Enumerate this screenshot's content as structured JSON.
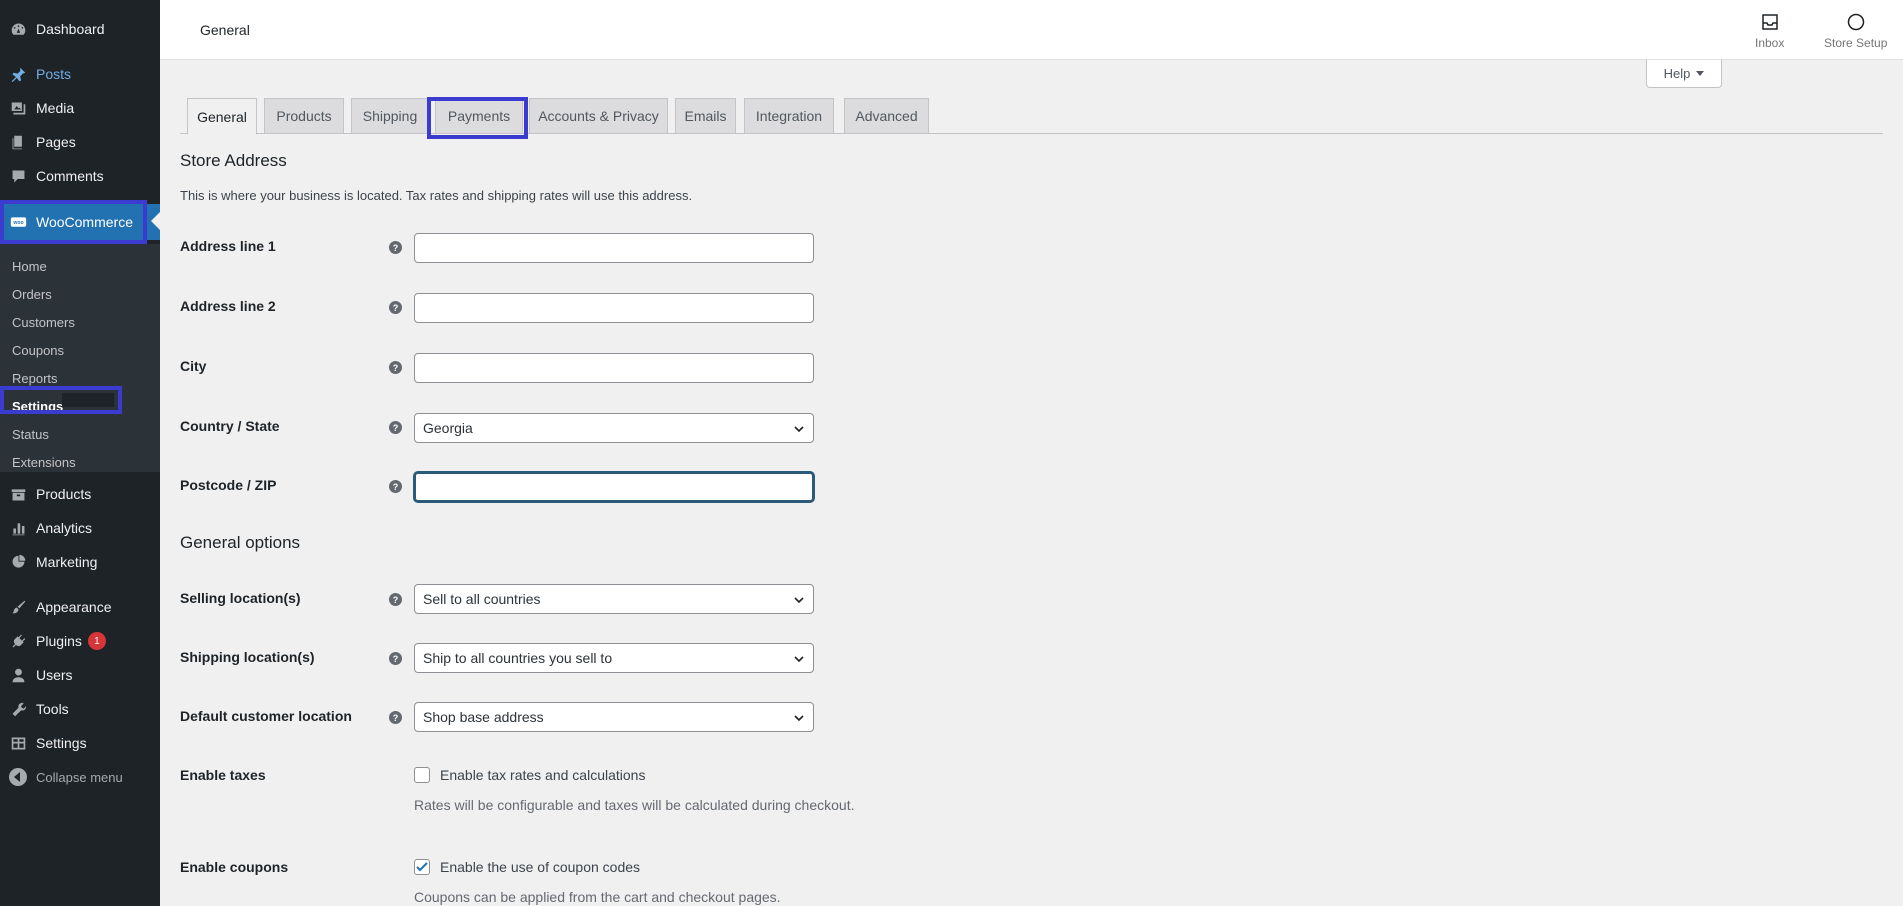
{
  "sidebar": {
    "top_items": [
      {
        "label": "Dashboard",
        "icon": "dashboard-icon"
      },
      {
        "label": "Posts",
        "icon": "pin-icon"
      },
      {
        "label": "Media",
        "icon": "media-icon"
      },
      {
        "label": "Pages",
        "icon": "pages-icon"
      },
      {
        "label": "Comments",
        "icon": "comment-icon"
      }
    ],
    "woocommerce": {
      "label": "WooCommerce",
      "icon": "woo-icon"
    },
    "submenu": [
      "Home",
      "Orders",
      "Customers",
      "Coupons",
      "Reports",
      "Settings",
      "Status",
      "Extensions"
    ],
    "bottom_items": [
      {
        "label": "Products",
        "icon": "products-icon"
      },
      {
        "label": "Analytics",
        "icon": "analytics-icon"
      },
      {
        "label": "Marketing",
        "icon": "marketing-icon"
      },
      {
        "label": "Appearance",
        "icon": "brush-icon"
      },
      {
        "label": "Plugins",
        "icon": "plugin-icon",
        "badge": "1"
      },
      {
        "label": "Users",
        "icon": "user-icon"
      },
      {
        "label": "Tools",
        "icon": "wrench-icon"
      },
      {
        "label": "Settings",
        "icon": "settings-icon"
      },
      {
        "label": "Collapse menu",
        "icon": "collapse-icon"
      }
    ]
  },
  "header": {
    "title": "General",
    "inbox_label": "Inbox",
    "store_setup_label": "Store Setup",
    "help_label": "Help"
  },
  "tabs": [
    "General",
    "Products",
    "Shipping",
    "Payments",
    "Accounts & Privacy",
    "Emails",
    "Integration",
    "Advanced"
  ],
  "store_address": {
    "title": "Store Address",
    "description": "This is where your business is located. Tax rates and shipping rates will use this address.",
    "address1_label": "Address line 1",
    "address1_value": "",
    "address2_label": "Address line 2",
    "address2_value": "",
    "city_label": "City",
    "city_value": "",
    "country_label": "Country / State",
    "country_value": "Georgia",
    "postcode_label": "Postcode / ZIP",
    "postcode_value": ""
  },
  "general_options": {
    "title": "General options",
    "selling_label": "Selling location(s)",
    "selling_value": "Sell to all countries",
    "shipping_label": "Shipping location(s)",
    "shipping_value": "Ship to all countries you sell to",
    "customer_label": "Default customer location",
    "customer_value": "Shop base address",
    "taxes_label": "Enable taxes",
    "taxes_checkbox_label": "Enable tax rates and calculations",
    "taxes_checked": false,
    "taxes_desc": "Rates will be configurable and taxes will be calculated during checkout.",
    "coupons_label": "Enable coupons",
    "coupons_checkbox_label": "Enable the use of coupon codes",
    "coupons_checked": true,
    "coupons_desc": "Coupons can be applied from the cart and checkout pages."
  },
  "colors": {
    "sidebar_bg": "#1d2327",
    "submenu_bg": "#2c3338",
    "accent": "#2271b1",
    "highlight": "#3b3bd0",
    "badge": "#d63638"
  }
}
